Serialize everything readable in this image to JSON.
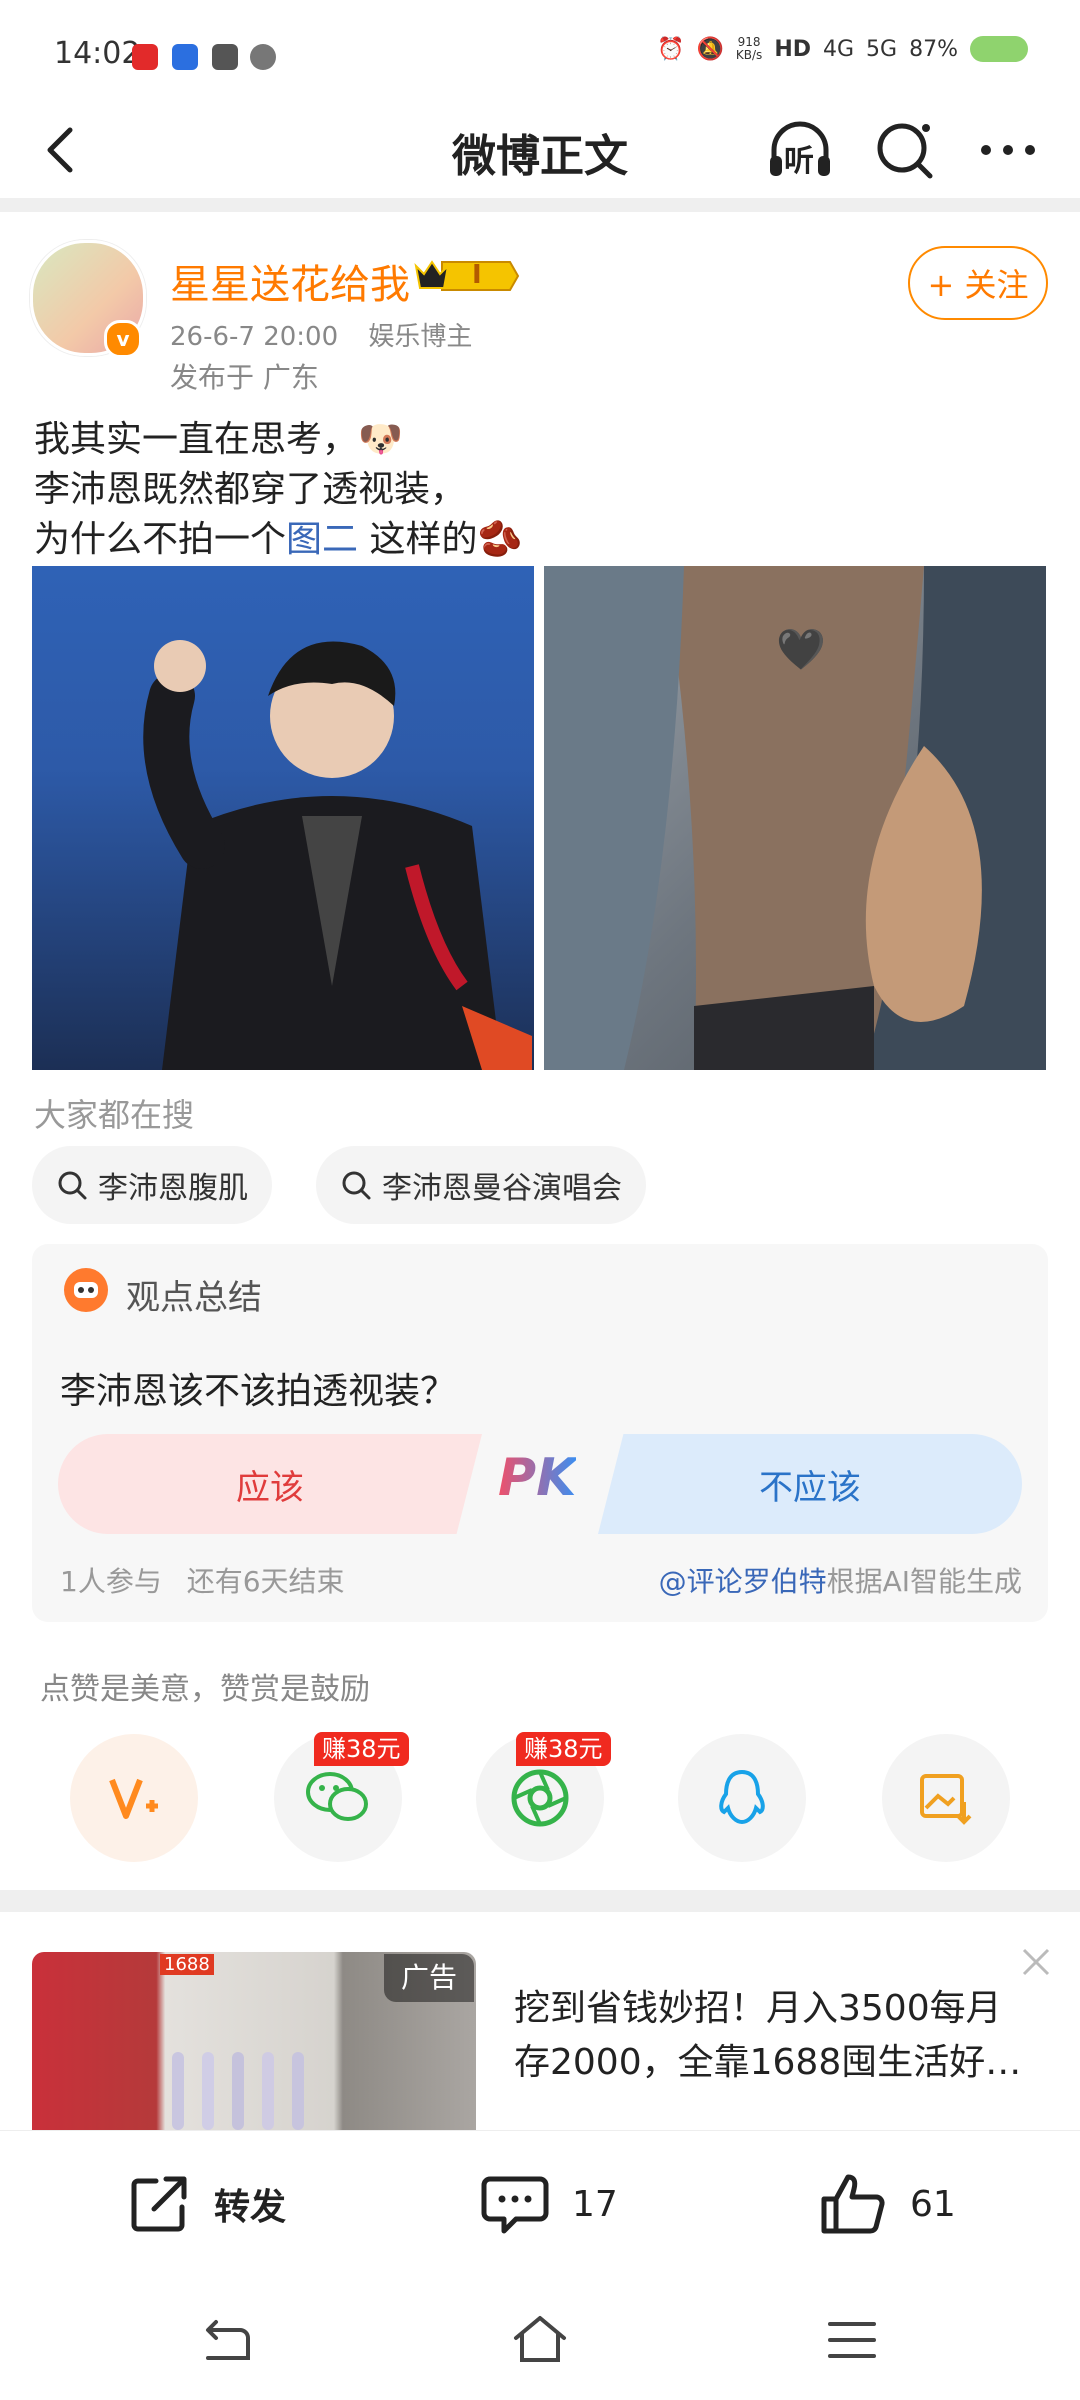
{
  "status_bar": {
    "time": "14:02",
    "net_speed_value": "918",
    "net_speed_unit": "KB/s",
    "hd": "HD",
    "net_4g": "4G",
    "net_5g": "5G",
    "battery": "87%"
  },
  "header": {
    "title": "微博正文",
    "listen_label": "听"
  },
  "post": {
    "author": "星星送花给我",
    "rank_badge": "I",
    "date": "26-6-7 20:00",
    "role": "娱乐博主",
    "location": "发布于 广东",
    "follow_label": "+ 关注",
    "text_line1": "我其实一直在思考，",
    "text_line2": "李沛恩既然都穿了透视装，",
    "text_line3_prefix": "为什么不拍一个",
    "text_line3_link": "图二",
    "text_line3_suffix": "这样的",
    "image2_emoji": "🖤"
  },
  "trending": {
    "label": "大家都在搜",
    "chips": [
      "李沛恩腹肌",
      "李沛恩曼谷演唱会"
    ]
  },
  "poll": {
    "header": "观点总结",
    "question": "李沛恩该不该拍透视装？",
    "option_yes": "应该",
    "pk": "PK",
    "option_no": "不应该",
    "participants": "1人参与",
    "remaining": "还有6天结束",
    "source_author": "@评论罗伯特",
    "source_suffix": "根据AI智能生成"
  },
  "reward": {
    "hint": "点赞是美意，赞赏是鼓励",
    "earn_badge": "赚38元"
  },
  "ad": {
    "badge": "广告",
    "img_tag": "1688",
    "text": "挖到省钱妙招！月入3500每月存2000，全靠1688囤生活好…"
  },
  "bottom": {
    "repost": "转发",
    "comments": "17",
    "likes": "61"
  },
  "colors": {
    "accent": "#ff7a00",
    "link": "#3a68b8",
    "yes_bg": "#fde4e4",
    "yes_text": "#e03c3c",
    "no_bg": "#dcebfb",
    "no_text": "#2a73c8"
  }
}
